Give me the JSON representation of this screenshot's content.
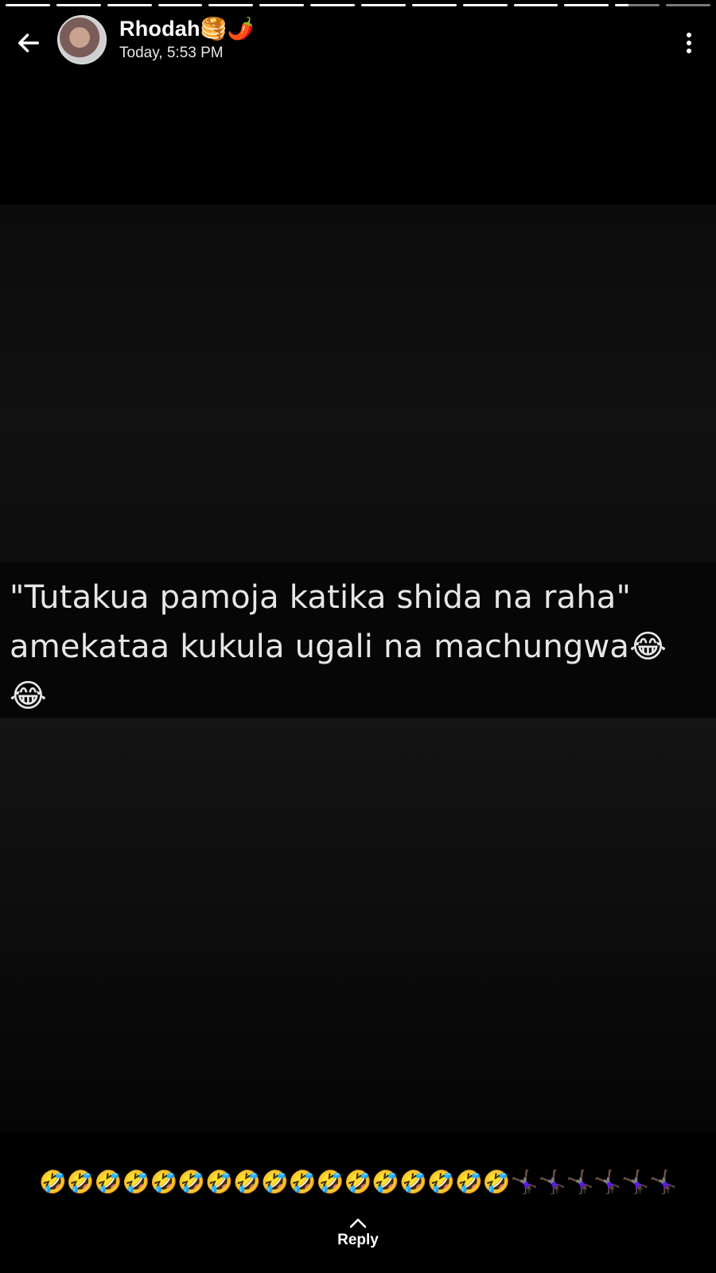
{
  "status": {
    "segments_total": 14,
    "segments_viewed": 12,
    "current_progress": 0.3
  },
  "header": {
    "name": "Rhodah🥞🌶️",
    "time": "Today, 5:53 PM",
    "back_icon": "arrow-left-icon",
    "menu_icon": "more-vertical-icon"
  },
  "photo": {
    "caption_lines": [
      "\"Tutakua pamoja katika shida na raha\"",
      "amekataa kukula ugali na machungwa😂",
      "😂"
    ]
  },
  "status_caption": "🤣🤣🤣🤣🤣🤣🤣🤣🤣🤣🤣🤣🤣🤣🤣🤣🤣🤸🏿‍♀️🤸🏿‍♀️🤸🏿‍♀️🤸🏿‍♀️🤸🏿‍♀️🤸🏿‍♀️",
  "reply": {
    "label": "Reply",
    "icon": "chevron-up-icon"
  },
  "colors": {
    "background": "#000000",
    "progress_done": "#ffffff",
    "progress_pending": "#7a7a7a"
  }
}
